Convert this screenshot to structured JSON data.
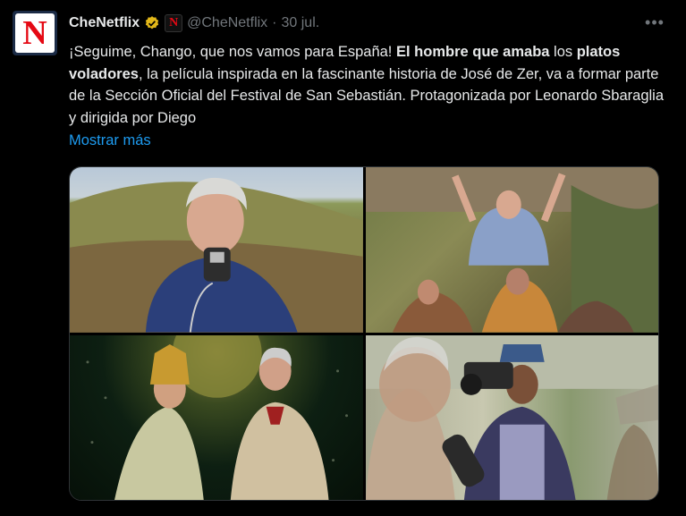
{
  "tweet": {
    "display_name": "CheNetflix",
    "handle": "@CheNetflix",
    "separator": "·",
    "date": "30 jul.",
    "more_icon": "more-horizontal-icon",
    "text_part1": "¡Seguime, Chango, que nos vamos para España! ",
    "text_bold1": "El hombre que amaba",
    "text_part2": " los ",
    "text_bold2": "platos voladores",
    "text_part3": ", la película inspirada en la fascinante historia de José de Zer, va a formar parte de la Sección Oficial del Festival de San Sebastián. Protagonizada por Leonardo Sbaraglia y dirigida por Diego",
    "show_more": "Mostrar más",
    "avatar_letter": "N",
    "badge_letter": "N"
  },
  "colors": {
    "background": "#000000",
    "text": "#e7e9ea",
    "secondary": "#71767b",
    "link": "#1d9bf0",
    "verified_gold": "#e2b719",
    "netflix_red": "#e50914"
  }
}
